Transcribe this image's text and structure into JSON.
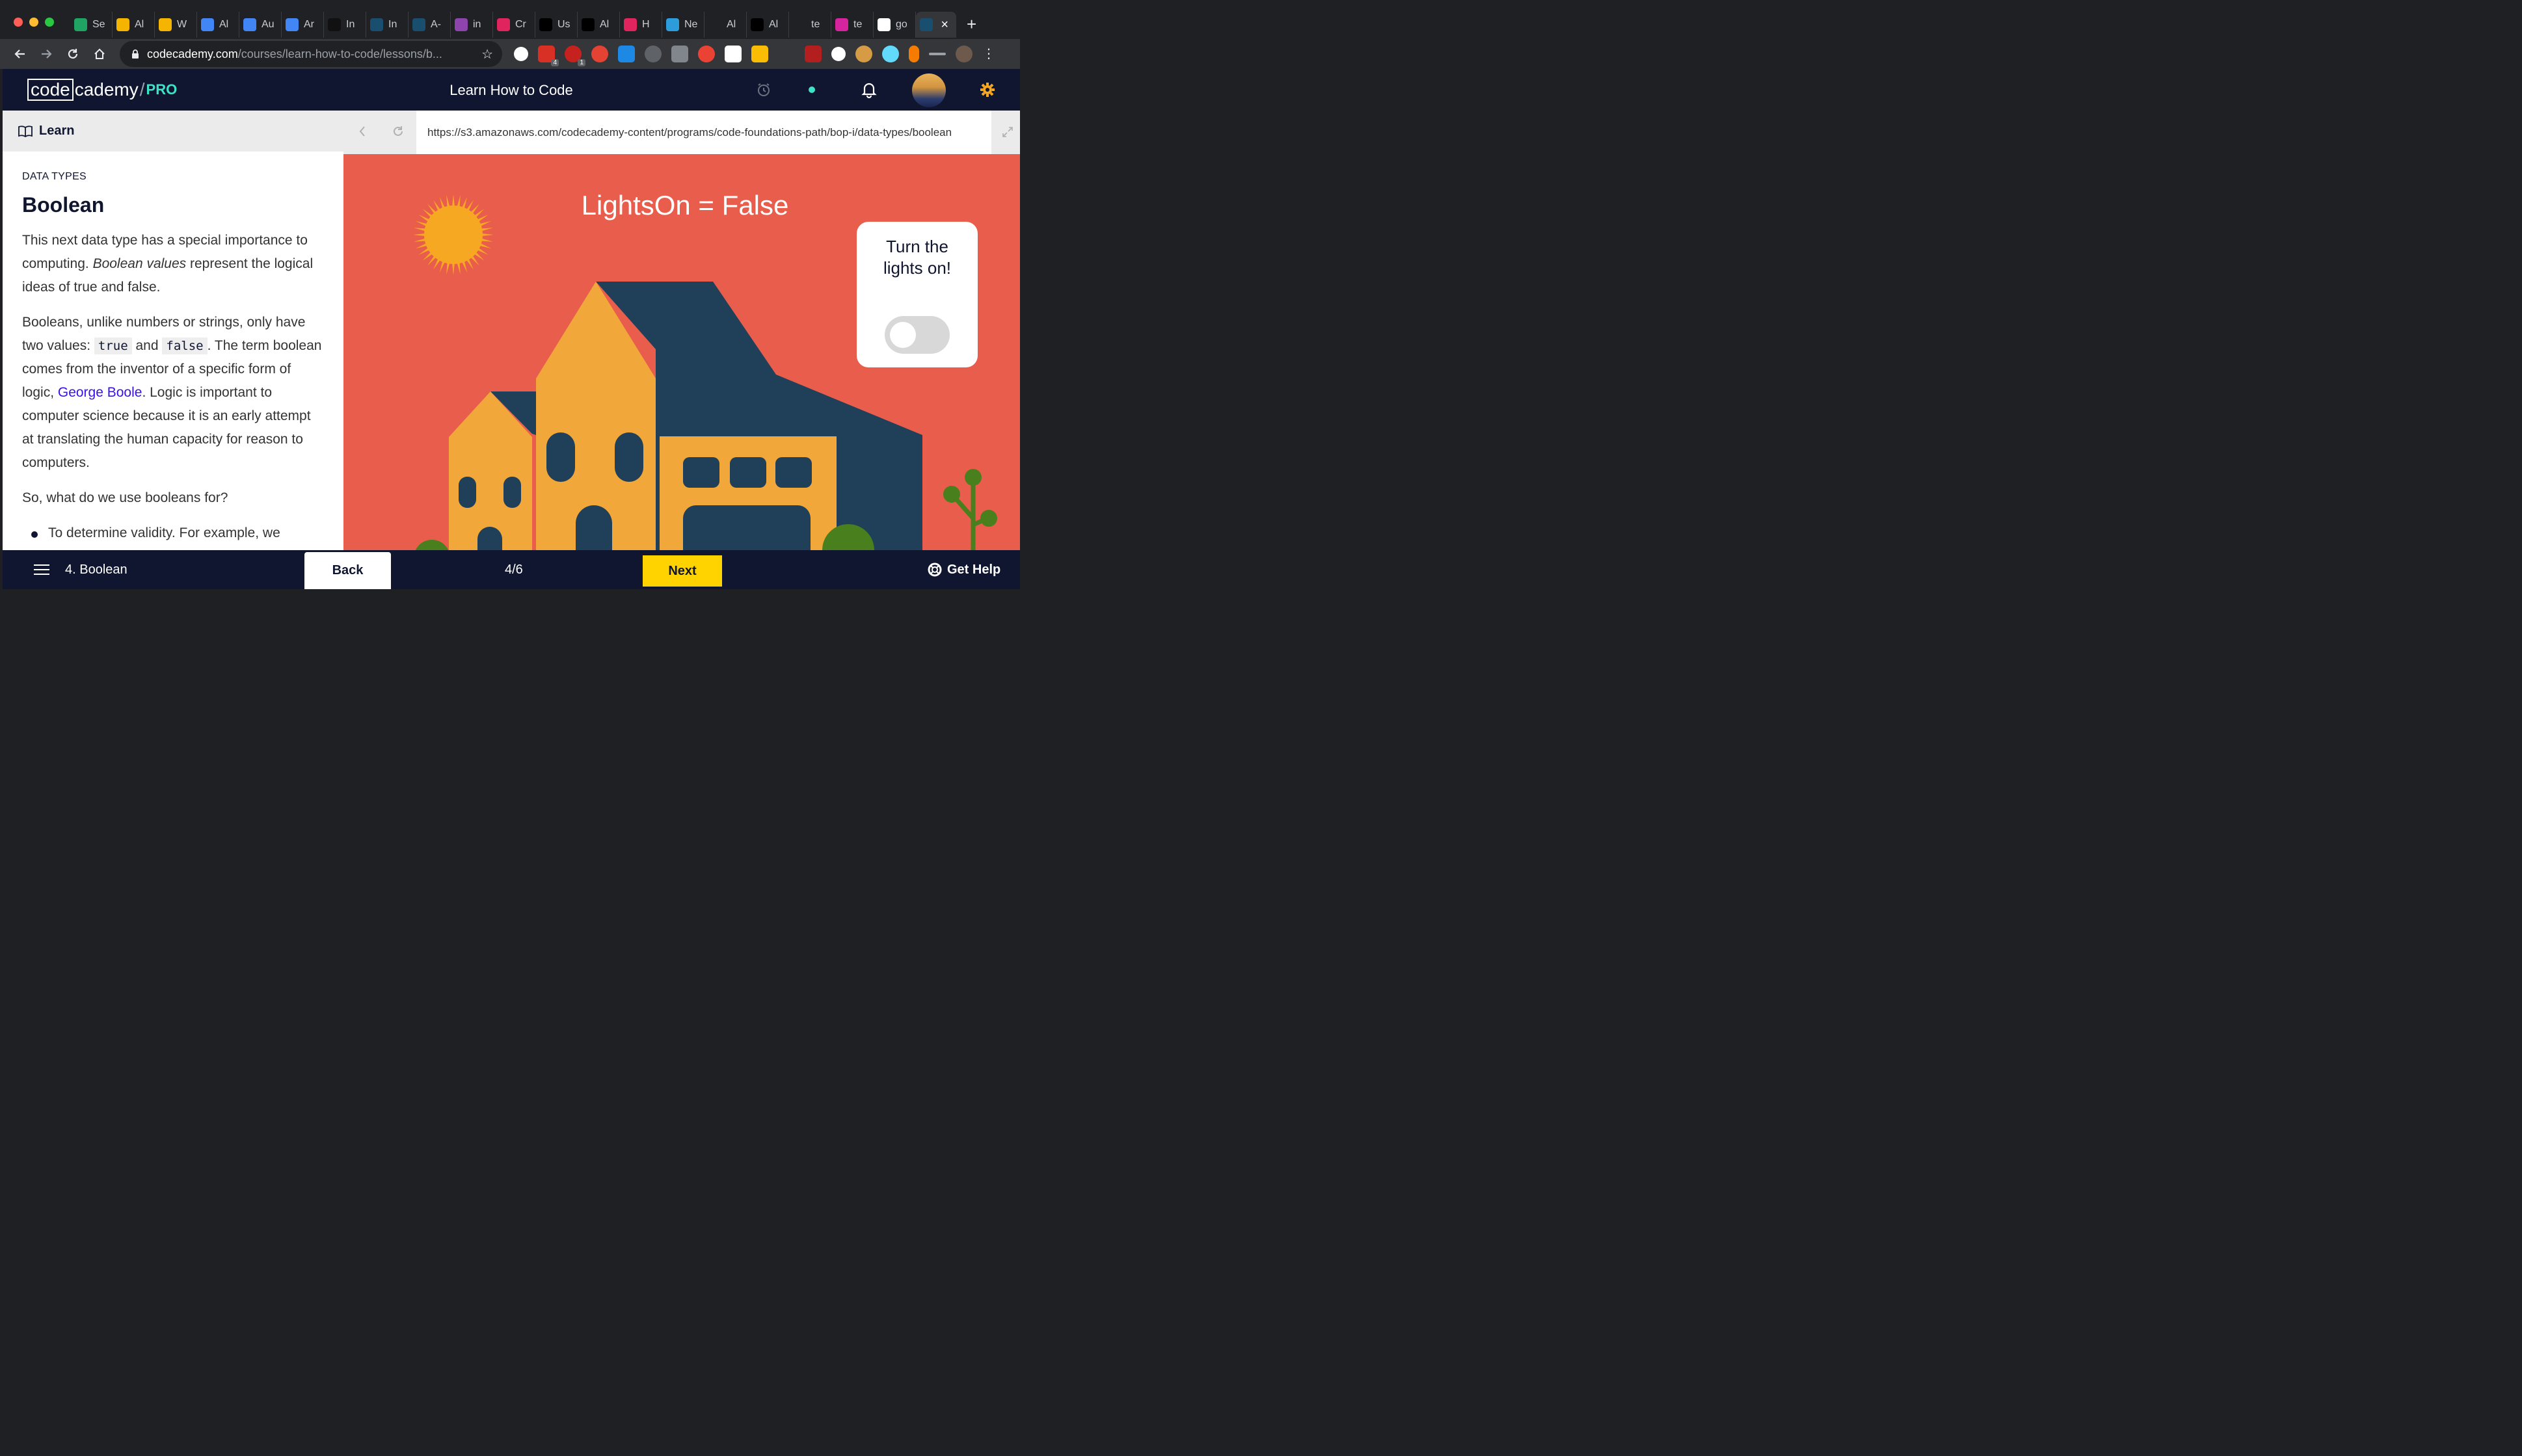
{
  "browser": {
    "tabs": [
      {
        "label": "Se",
        "icon": "google-drive-icon",
        "color": "#1fa463"
      },
      {
        "label": "Al",
        "icon": "google-slides-icon",
        "color": "#f4b400"
      },
      {
        "label": "W",
        "icon": "google-slides-icon",
        "color": "#f4b400"
      },
      {
        "label": "Al",
        "icon": "google-docs-icon",
        "color": "#4285f4"
      },
      {
        "label": "Au",
        "icon": "google-docs-icon",
        "color": "#4285f4"
      },
      {
        "label": "Ar",
        "icon": "google-docs-icon",
        "color": "#4285f4"
      },
      {
        "label": "In",
        "icon": "amazon-icon",
        "color": "#111111"
      },
      {
        "label": "In",
        "icon": "codecademy-icon",
        "color": "#1a4e6e"
      },
      {
        "label": "A-",
        "icon": "codecademy-icon",
        "color": "#1a4e6e"
      },
      {
        "label": "in",
        "icon": "stack-icon",
        "color": "#8e44ad"
      },
      {
        "label": "Cr",
        "icon": "acrobat-icon",
        "color": "#e0245e"
      },
      {
        "label": "Us",
        "icon": "medium-icon",
        "color": "#000000"
      },
      {
        "label": "Al",
        "icon": "medium-icon",
        "color": "#000000"
      },
      {
        "label": "H",
        "icon": "acrobat-icon",
        "color": "#e0245e"
      },
      {
        "label": "Ne",
        "icon": "box-icon",
        "color": "#2d9cdb"
      },
      {
        "label": "Al",
        "icon": "github-icon",
        "color": "#202124"
      },
      {
        "label": "Al",
        "icon": "medium-icon",
        "color": "#000000"
      },
      {
        "label": "te",
        "icon": "bolt-icon",
        "color": "#202124"
      },
      {
        "label": "te",
        "icon": "instagram-icon",
        "color": "#d6249f"
      },
      {
        "label": "go",
        "icon": "google-icon",
        "color": "#ffffff"
      }
    ],
    "address": {
      "domain": "codecademy.com",
      "path": "/courses/learn-how-to-code/lessons/b..."
    },
    "extension_badges": [
      "4",
      "1"
    ]
  },
  "header": {
    "logo_code": "code",
    "logo_rest": "cademy",
    "logo_slash": "/",
    "logo_pro": "PRO",
    "course_title": "Learn How to Code"
  },
  "learn": {
    "tab_label": "Learn",
    "eyebrow": "DATA TYPES",
    "title": "Boolean",
    "p1_a": "This next data type has a special importance to computing. ",
    "p1_em": "Boolean values",
    "p1_b": " represent the logical ideas of true and false.",
    "p2_a": "Booleans, unlike numbers or strings, only have two values: ",
    "p2_code1": "true",
    "p2_and": " and ",
    "p2_code2": "false",
    "p2_b": ". The term boolean comes from the inventor of a specific form of logic, ",
    "p2_link": "George Boole",
    "p2_c": ". Logic is important to computer science because it is an early attempt at translating the human capacity for reason to computers.",
    "p3": "So, what do we use booleans for?",
    "bullet1": "To determine validity. For example, we"
  },
  "pane": {
    "url": "https://s3.amazonaws.com/codecademy-content/programs/code-foundations-path/bop-i/data-types/boolean",
    "headline": "LightsOn = False",
    "toggle_text": "Turn the lights on!",
    "lights_on": false
  },
  "footer": {
    "lesson": "4. Boolean",
    "back": "Back",
    "progress": "4/6",
    "next": "Next",
    "help": "Get Help"
  },
  "colors": {
    "stage_bg": "#e85d4c",
    "house_yellow": "#f2a73b",
    "house_dark": "#203f58",
    "sun": "#f7a823",
    "next_button": "#ffd300",
    "pro_teal": "#3ee2c9"
  }
}
